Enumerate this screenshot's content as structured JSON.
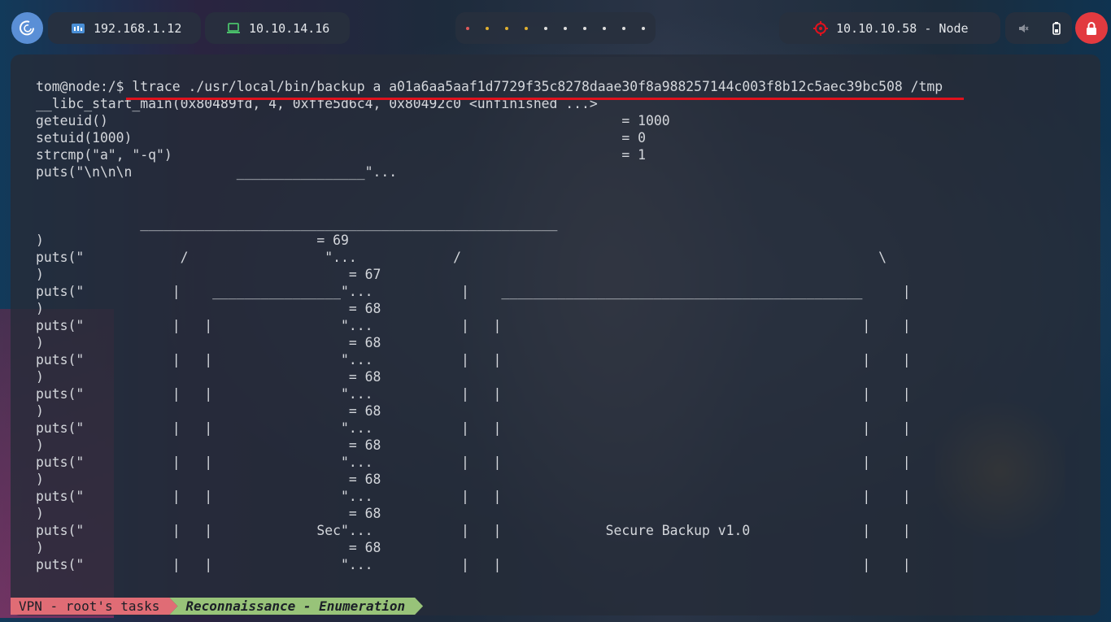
{
  "topbar": {
    "ip_local": "192.168.1.12",
    "ip_vpn": "10.10.14.16",
    "target": "10.10.10.58 - Node",
    "workspace_dot_colors": [
      "#e05a5a",
      "#e0b030",
      "#e0b030",
      "#e0b030",
      "#dddddd",
      "#dddddd",
      "#dddddd",
      "#dddddd",
      "#dddddd",
      "#dddddd"
    ],
    "icons": [
      "debian-logo-icon",
      "network-icon",
      "laptop-icon",
      "target-icon",
      "mute-icon",
      "battery-icon",
      "lock-icon"
    ]
  },
  "terminal": {
    "lines": [
      "tom@node:/$ ltrace ./usr/local/bin/backup a a01a6aa5aaf1d7729f35c8278daae30f8a988257144c003f8b12c5aec39bc508 /tmp",
      "__libc_start_main(0x80489fd, 4, 0xffe5d6c4, 0x80492c0 <unfinished ...>",
      "geteuid()                                                                = 1000",
      "setuid(1000)                                                             = 0",
      "strcmp(\"a\", \"-q\")                                                        = 1",
      "puts(\"\\n\\n\\n             ________________\"...",
      "",
      "",
      "             ____________________________________________________",
      ")                                  = 69",
      "puts(\"            /                 \"...            /                                                    \\",
      ")                                      = 67",
      "puts(\"           |    ________________\"...           |    _____________________________________________     |",
      ")                                      = 68",
      "puts(\"           |   |                \"...           |   |                                             |    |",
      ")                                      = 68",
      "puts(\"           |   |                \"...           |   |                                             |    |",
      ")                                      = 68",
      "puts(\"           |   |                \"...           |   |                                             |    |",
      ")                                      = 68",
      "puts(\"           |   |                \"...           |   |                                             |    |",
      ")                                      = 68",
      "puts(\"           |   |                \"...           |   |                                             |    |",
      ")                                      = 68",
      "puts(\"           |   |                \"...           |   |                                             |    |",
      ")                                      = 68",
      "puts(\"           |   |             Sec\"...           |   |             Secure Backup v1.0              |    |",
      ")                                      = 68",
      "puts(\"           |   |                \"...           |   |                                             |    |"
    ]
  },
  "statusbar": {
    "session": "VPN - root's tasks",
    "window": "Reconnaissance - Enumeration",
    "session_color": "#e06c75",
    "window_color": "#98c379"
  }
}
